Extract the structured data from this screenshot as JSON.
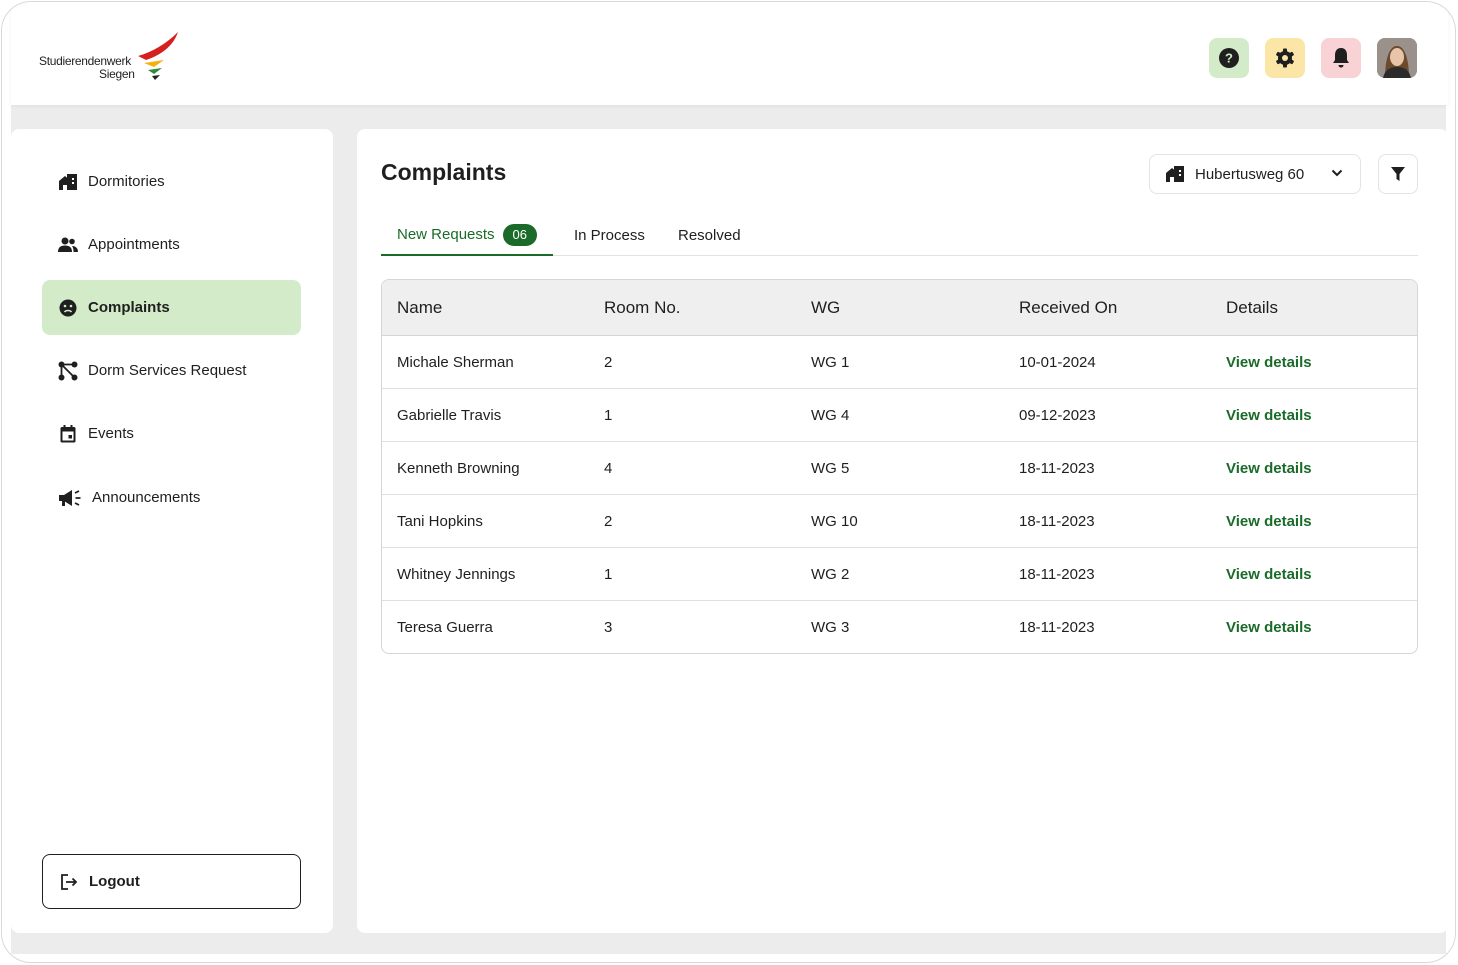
{
  "brand": {
    "line1": "Studierendenwerk",
    "line2": "Siegen"
  },
  "header": {
    "help_icon": "help-circle-icon",
    "settings_icon": "gear-icon",
    "notifications_icon": "bell-icon",
    "help_bg": "#d4ebc9",
    "settings_bg": "#fbe6a7",
    "notifications_bg": "#f9d2d5"
  },
  "sidebar": {
    "items": [
      {
        "label": "Dormitories",
        "icon": "building-icon"
      },
      {
        "label": "Appointments",
        "icon": "people-icon"
      },
      {
        "label": "Complaints",
        "icon": "sad-face-icon",
        "active": true
      },
      {
        "label": "Dorm Services Request",
        "icon": "nodes-icon"
      },
      {
        "label": "Events",
        "icon": "calendar-icon"
      },
      {
        "label": "Announcements",
        "icon": "megaphone-icon"
      }
    ],
    "logout_label": "Logout",
    "active_bg": "#d4ebc9"
  },
  "main": {
    "title": "Complaints",
    "dorm_select": {
      "value": "Hubertusweg 60"
    },
    "tabs": [
      {
        "label": "New Requests",
        "badge": "06",
        "active": true
      },
      {
        "label": "In Process"
      },
      {
        "label": "Resolved"
      }
    ],
    "accent": "#1a6b2a",
    "table": {
      "headers": [
        "Name",
        "Room No.",
        "WG",
        "Received On",
        "Details"
      ],
      "rows": [
        {
          "name": "Michale Sherman",
          "room": "2",
          "wg": "WG 1",
          "received": "10-01-2024",
          "details": "View details"
        },
        {
          "name": "Gabrielle Travis",
          "room": "1",
          "wg": "WG 4",
          "received": "09-12-2023",
          "details": "View details"
        },
        {
          "name": "Kenneth Browning",
          "room": "4",
          "wg": "WG 5",
          "received": "18-11-2023",
          "details": "View details"
        },
        {
          "name": "Tani Hopkins",
          "room": "2",
          "wg": "WG 10",
          "received": "18-11-2023",
          "details": "View details"
        },
        {
          "name": "Whitney Jennings",
          "room": "1",
          "wg": "WG 2",
          "received": "18-11-2023",
          "details": "View details"
        },
        {
          "name": "Teresa Guerra",
          "room": "3",
          "wg": "WG 3",
          "received": "18-11-2023",
          "details": "View details"
        }
      ]
    }
  }
}
